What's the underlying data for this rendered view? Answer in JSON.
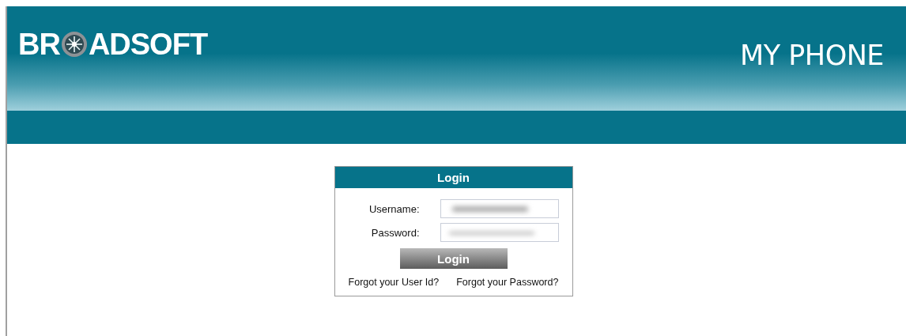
{
  "header": {
    "logo": {
      "before": "BR",
      "after": "ADSOFT"
    },
    "title": "MY PHONE"
  },
  "login": {
    "title": "Login",
    "fields": [
      {
        "label": "Username:",
        "kind": "text"
      },
      {
        "label": "Password:",
        "kind": "password"
      }
    ],
    "button": "Login",
    "links": [
      "Forgot your User Id?",
      "Forgot your Password?"
    ]
  }
}
